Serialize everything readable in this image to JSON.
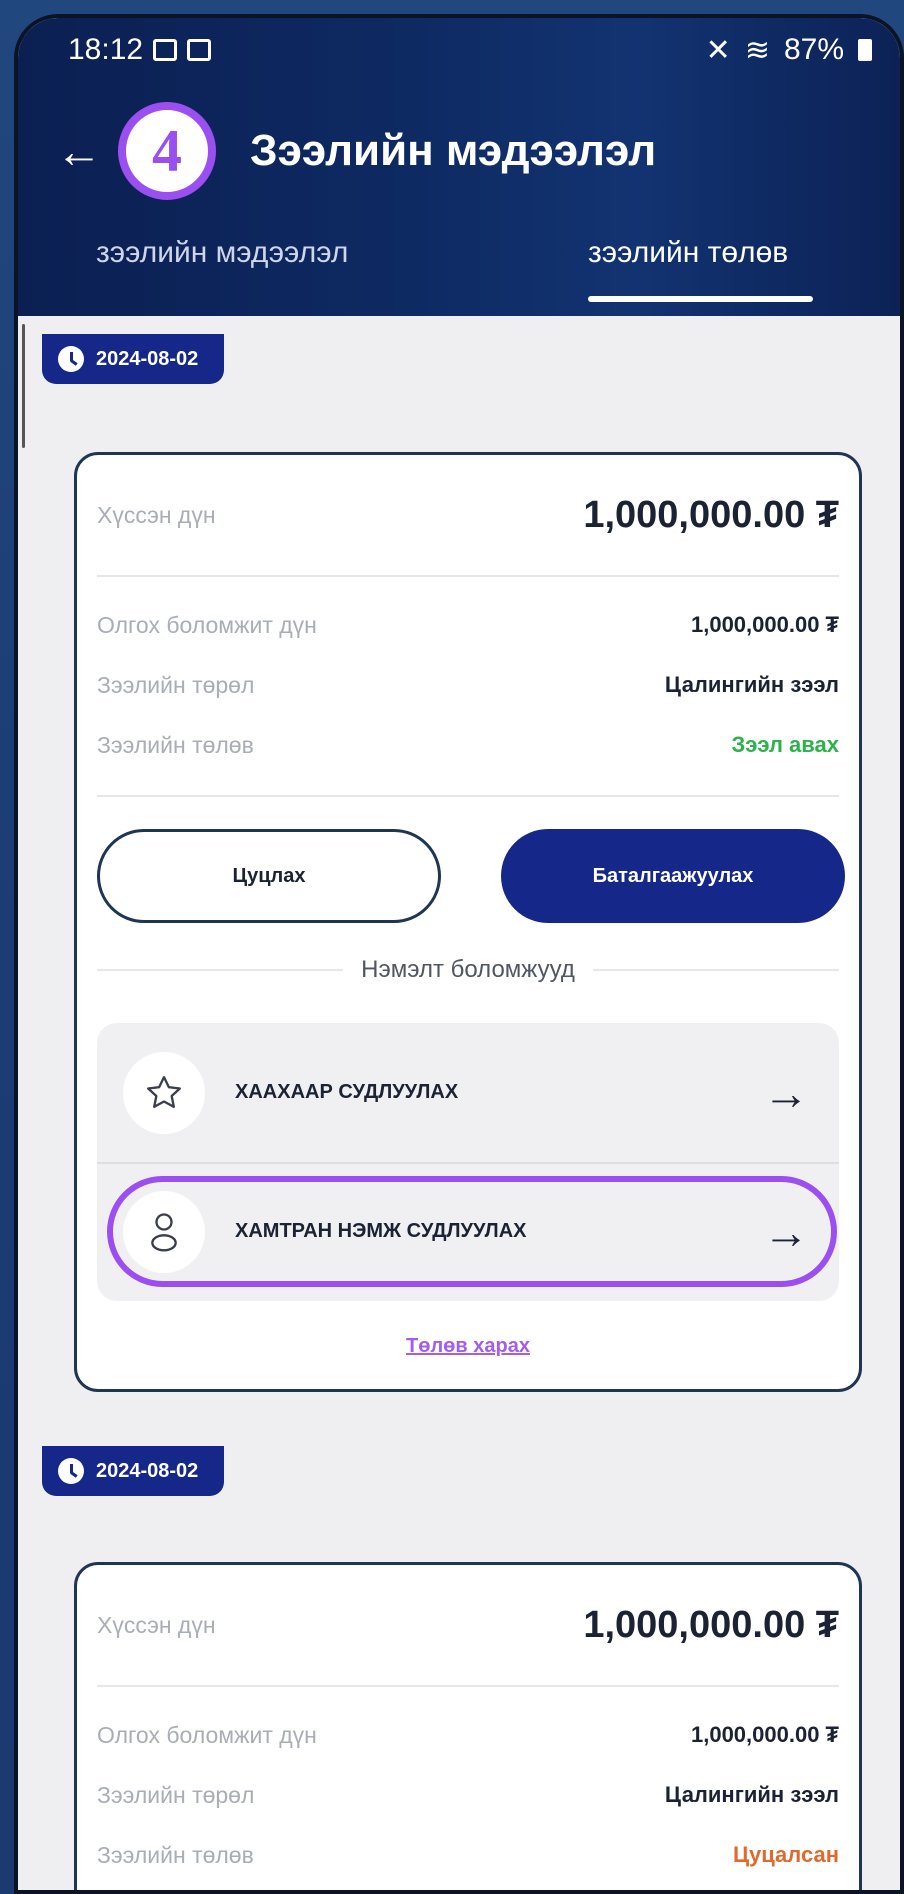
{
  "status_bar": {
    "time": "18:12",
    "battery": "87%"
  },
  "header": {
    "title": "Зээлийн мэдээлэл",
    "step_number": "4"
  },
  "tabs": [
    {
      "label": "зээлийн мэдээлэл",
      "active": false
    },
    {
      "label": "зээлийн төлөв",
      "active": true
    }
  ],
  "loans": [
    {
      "date": "2024-08-02",
      "requested_label": "Хүссэн дүн",
      "requested_value": "1,000,000.00 ₮",
      "available_label": "Олгох боломжит дүн",
      "available_value": "1,000,000.00 ₮",
      "type_label": "Зээлийн төрөл",
      "type_value": "Цалингийн зээл",
      "status_label": "Зээлийн төлөв",
      "status_value": "Зээл авах",
      "cancel_label": "Цуцлах",
      "confirm_label": "Баталгаажуулах",
      "extra_label": "Нэмэлт боломжууд",
      "options": [
        {
          "label": "ХААХААР СУДЛУУЛАХ",
          "icon": "star-icon"
        },
        {
          "label": "ХАМТРАН НЭМЖ СУДЛУУЛАХ",
          "icon": "person-icon"
        }
      ],
      "view_status_link": "Төлөв харах"
    },
    {
      "date": "2024-08-02",
      "requested_label": "Хүссэн дүн",
      "requested_value": "1,000,000.00 ₮",
      "available_label": "Олгох боломжит дүн",
      "available_value": "1,000,000.00 ₮",
      "type_label": "Зээлийн төрөл",
      "type_value": "Цалингийн зээл",
      "status_label": "Зээлийн төлөв",
      "status_value": "Цуцалсан"
    }
  ],
  "colors": {
    "primary": "#15288a",
    "accent": "#9b4ff0",
    "success": "#2bb24a",
    "danger": "#e2692e"
  }
}
